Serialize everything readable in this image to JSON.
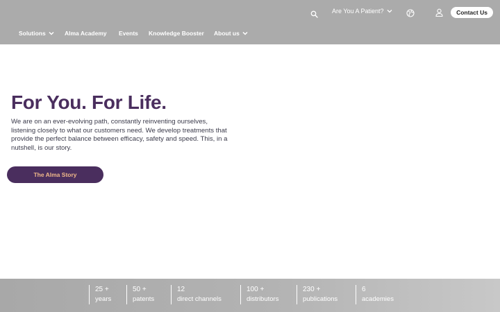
{
  "header": {
    "patient_label": "Are You A Patient?",
    "contact_label": "Contact Us",
    "nav": [
      {
        "label": "Solutions",
        "has_dropdown": true
      },
      {
        "label": "Alma Academy",
        "has_dropdown": false
      },
      {
        "label": "Events",
        "has_dropdown": false
      },
      {
        "label": "Knowledge Booster",
        "has_dropdown": false
      },
      {
        "label": "About us",
        "has_dropdown": true
      }
    ],
    "icons": [
      "search-icon",
      "globe-icon",
      "user-icon",
      "chevron-down-icon"
    ]
  },
  "hero": {
    "title": "For You. For Life.",
    "text": "We are on an ever-evolving path, constantly reinventing ourselves, listening closely to what our customers need. We develop treatments that provide the perfect balance between efficacy, safety and speed. This, in a nutshell, is our story.",
    "button_label": "The Alma Story"
  },
  "stats": [
    {
      "number": "25 +",
      "label": "years"
    },
    {
      "number": "50 +",
      "label": "patents"
    },
    {
      "number": "12",
      "label": "direct channels"
    },
    {
      "number": "100 +",
      "label": "distributors"
    },
    {
      "number": "230 +",
      "label": "publications"
    },
    {
      "number": "6",
      "label": "academies"
    }
  ],
  "colors": {
    "header_bg": "#ababab",
    "brand_purple": "#4a2e5e",
    "button_text": "#f0b98a",
    "stats_bg": "#b3b3b3"
  }
}
